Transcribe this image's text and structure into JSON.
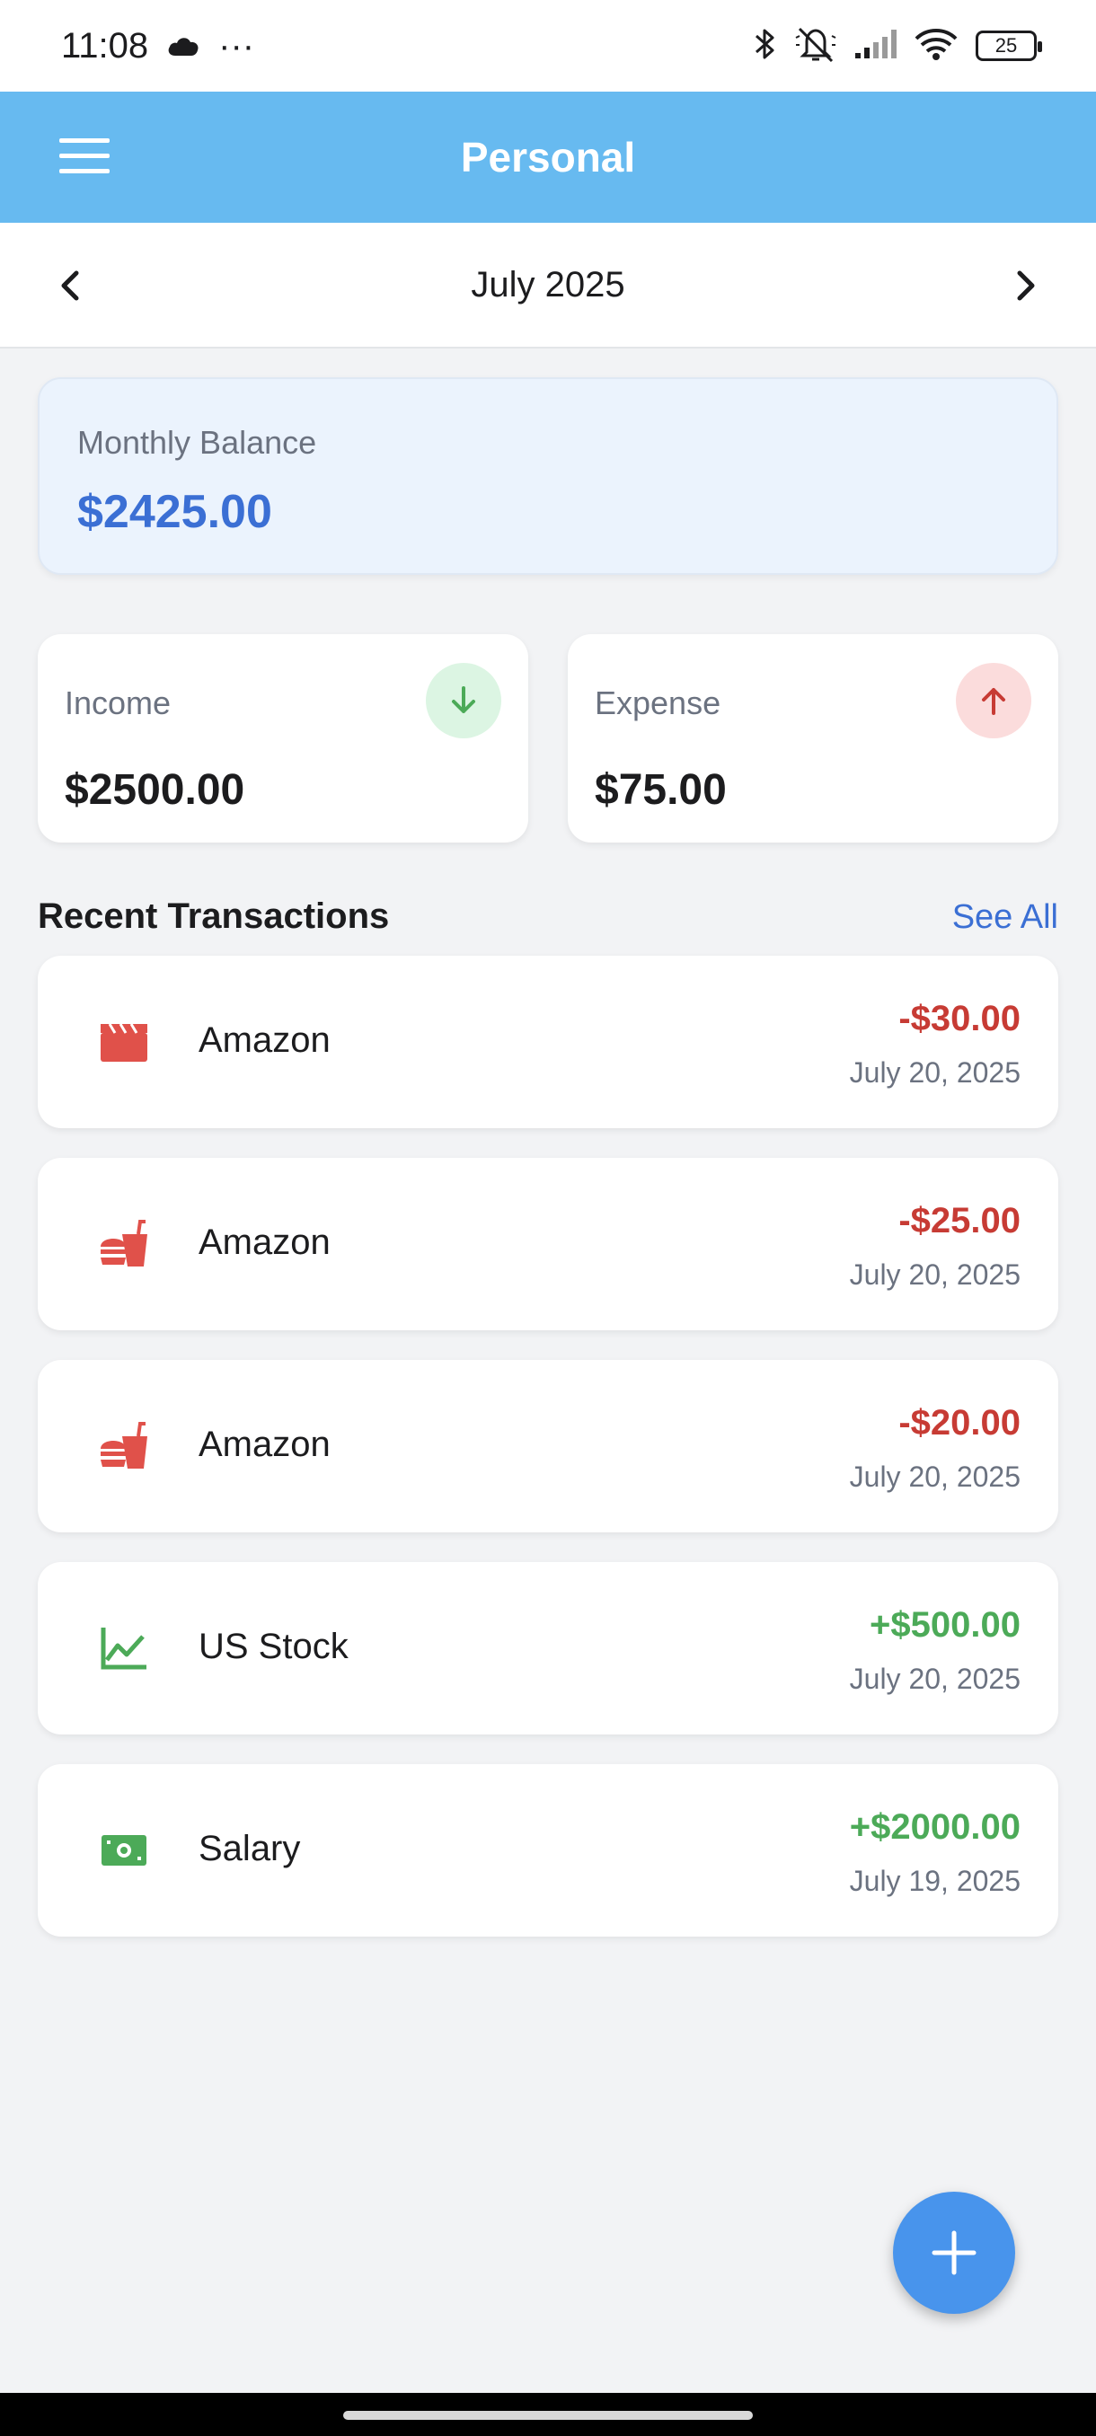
{
  "status_bar": {
    "time": "11:08",
    "more": "···",
    "battery": "25"
  },
  "app_bar": {
    "title": "Personal"
  },
  "month_nav": {
    "label": "July 2025"
  },
  "balance": {
    "label": "Monthly Balance",
    "value": "$2425.00",
    "color": "#3b6fd4"
  },
  "income": {
    "label": "Income",
    "value": "$2500.00",
    "icon": "arrow-down-icon"
  },
  "expense": {
    "label": "Expense",
    "value": "$75.00",
    "icon": "arrow-up-icon"
  },
  "recent": {
    "title": "Recent Transactions",
    "see_all": "See All"
  },
  "transactions": [
    {
      "name": "Amazon",
      "amount": "-$30.00",
      "date": "July 20, 2025",
      "icon": "clapperboard-icon",
      "type": "expense"
    },
    {
      "name": "Amazon",
      "amount": "-$25.00",
      "date": "July 20, 2025",
      "icon": "fast-food-icon",
      "type": "expense"
    },
    {
      "name": "Amazon",
      "amount": "-$20.00",
      "date": "July 20, 2025",
      "icon": "fast-food-icon",
      "type": "expense"
    },
    {
      "name": "US Stock",
      "amount": "+$500.00",
      "date": "July 20, 2025",
      "icon": "line-chart-icon",
      "type": "income"
    },
    {
      "name": "Salary",
      "amount": "+$2000.00",
      "date": "July 19, 2025",
      "icon": "money-bill-icon",
      "type": "income"
    }
  ],
  "colors": {
    "app_bar": "#67baf0",
    "expense": "#c73b34",
    "income": "#4caa58",
    "fab": "#4894ec"
  }
}
